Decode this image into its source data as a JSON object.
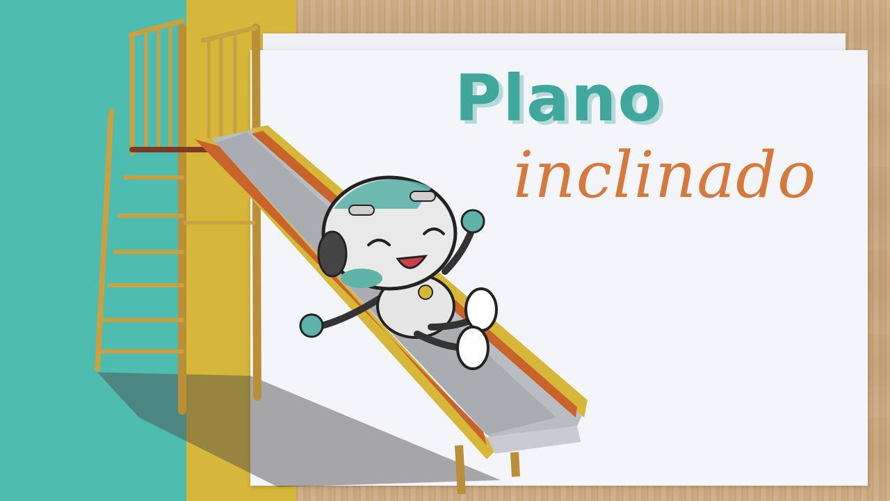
{
  "title": {
    "line1": "Plano",
    "line2": "inclinado"
  },
  "colors": {
    "teal": "#4fbcb0",
    "yellow": "#d7b73a",
    "wood": "#c9a77e",
    "title_teal": "#3fa79c",
    "title_orange": "#d57a3f",
    "slide_orange": "#c8632b",
    "slide_metal": "#b9bcc0"
  },
  "illustration": {
    "subject": "robot-sliding",
    "object": "playground-slide"
  }
}
